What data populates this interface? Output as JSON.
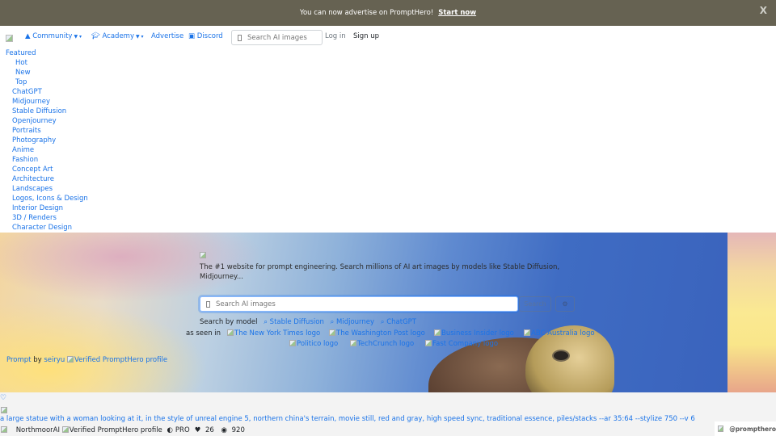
{
  "banner": {
    "message": "You can now advertise on PromptHero!",
    "cta": "Start now",
    "close": "X"
  },
  "nav": {
    "community": "Community",
    "academy": "Academy",
    "advertise": "Advertise",
    "discord": "Discord",
    "search_placeholder": "Search AI images",
    "login": "Log in",
    "signup": "Sign up"
  },
  "menu": {
    "featured": "Featured",
    "featured_sub": [
      "Hot",
      "New",
      "Top"
    ],
    "categories": [
      "ChatGPT",
      "Midjourney",
      "Stable Diffusion",
      "Openjourney",
      "Portraits",
      "Photography",
      "Anime",
      "Fashion",
      "Concept Art",
      "Architecture",
      "Landscapes",
      "Logos, Icons & Design",
      "Interior Design",
      "3D / Renders",
      "Character Design"
    ]
  },
  "hero": {
    "description": "The #1 website for prompt engineering. Search millions of AI art images by models like Stable Diffusion, Midjourney...",
    "search_placeholder": "Search AI images",
    "search_button": "Search",
    "filter_icon": "filter-icon",
    "search_by_model_label": "Search by model",
    "models": [
      "Stable Diffusion",
      "Midjourney",
      "ChatGPT"
    ],
    "as_seen_in_label": "as seen in",
    "press_row1": [
      "The New York Times logo",
      "The Washington Post logo",
      "Business Insider logo",
      "ABC Australia logo"
    ],
    "press_row2": [
      "Politico logo",
      "TechCrunch logo",
      "Fast Company logo"
    ],
    "credit_prompt": "Prompt",
    "credit_by": "by",
    "credit_user": "seiryu",
    "credit_verified_alt": "Verified PromptHero profile"
  },
  "feed": {
    "prompt": "a large statue with a woman looking at it, in the style of unreal engine 5, northern china's terrain, movie still, red and gray, high speed sync, traditional essence, piles/stacks --ar 35:64 --stylize 750 --v 6",
    "author": "NorthmoorAI",
    "verified_alt": "Verified PromptHero profile",
    "badge": "PRO",
    "likes": "26",
    "views": "920",
    "watermark": "@prompthero"
  },
  "colors": {
    "link": "#1a73e8",
    "banner_bg": "#666252"
  }
}
